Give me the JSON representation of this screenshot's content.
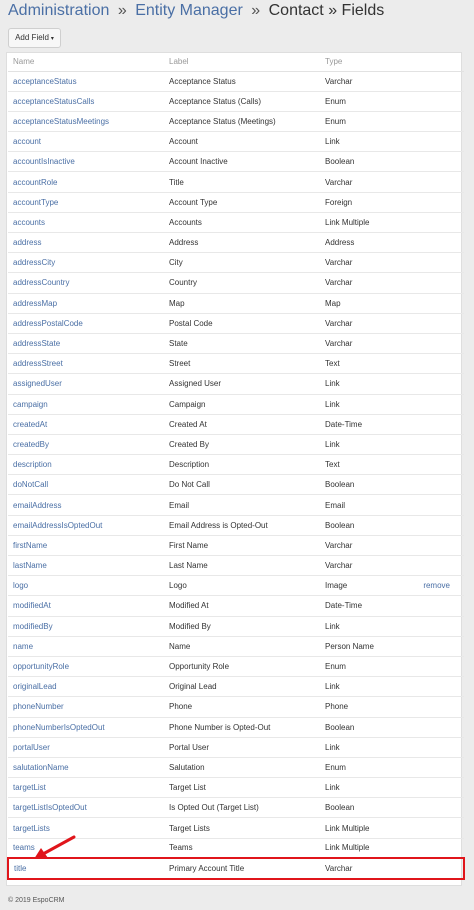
{
  "breadcrumb": {
    "administration": "Administration",
    "sep1": "»",
    "entity_manager": "Entity Manager",
    "sep2": "»",
    "current": "Contact » Fields"
  },
  "toolbar": {
    "add_field_label": "Add Field",
    "caret": "▾"
  },
  "table": {
    "headers": {
      "name": "Name",
      "label": "Label",
      "type": "Type"
    },
    "rows": [
      {
        "name": "acceptanceStatus",
        "label": "Acceptance Status",
        "type": "Varchar"
      },
      {
        "name": "acceptanceStatusCalls",
        "label": "Acceptance Status (Calls)",
        "type": "Enum"
      },
      {
        "name": "acceptanceStatusMeetings",
        "label": "Acceptance Status (Meetings)",
        "type": "Enum"
      },
      {
        "name": "account",
        "label": "Account",
        "type": "Link"
      },
      {
        "name": "accountIsInactive",
        "label": "Account Inactive",
        "type": "Boolean"
      },
      {
        "name": "accountRole",
        "label": "Title",
        "type": "Varchar"
      },
      {
        "name": "accountType",
        "label": "Account Type",
        "type": "Foreign"
      },
      {
        "name": "accounts",
        "label": "Accounts",
        "type": "Link Multiple"
      },
      {
        "name": "address",
        "label": "Address",
        "type": "Address"
      },
      {
        "name": "addressCity",
        "label": "City",
        "type": "Varchar"
      },
      {
        "name": "addressCountry",
        "label": "Country",
        "type": "Varchar"
      },
      {
        "name": "addressMap",
        "label": "Map",
        "type": "Map"
      },
      {
        "name": "addressPostalCode",
        "label": "Postal Code",
        "type": "Varchar"
      },
      {
        "name": "addressState",
        "label": "State",
        "type": "Varchar"
      },
      {
        "name": "addressStreet",
        "label": "Street",
        "type": "Text"
      },
      {
        "name": "assignedUser",
        "label": "Assigned User",
        "type": "Link"
      },
      {
        "name": "campaign",
        "label": "Campaign",
        "type": "Link"
      },
      {
        "name": "createdAt",
        "label": "Created At",
        "type": "Date-Time"
      },
      {
        "name": "createdBy",
        "label": "Created By",
        "type": "Link"
      },
      {
        "name": "description",
        "label": "Description",
        "type": "Text"
      },
      {
        "name": "doNotCall",
        "label": "Do Not Call",
        "type": "Boolean"
      },
      {
        "name": "emailAddress",
        "label": "Email",
        "type": "Email"
      },
      {
        "name": "emailAddressIsOptedOut",
        "label": "Email Address is Opted-Out",
        "type": "Boolean"
      },
      {
        "name": "firstName",
        "label": "First Name",
        "type": "Varchar"
      },
      {
        "name": "lastName",
        "label": "Last Name",
        "type": "Varchar"
      },
      {
        "name": "logo",
        "label": "Logo",
        "type": "Image",
        "action": "remove"
      },
      {
        "name": "modifiedAt",
        "label": "Modified At",
        "type": "Date-Time"
      },
      {
        "name": "modifiedBy",
        "label": "Modified By",
        "type": "Link"
      },
      {
        "name": "name",
        "label": "Name",
        "type": "Person Name"
      },
      {
        "name": "opportunityRole",
        "label": "Opportunity Role",
        "type": "Enum"
      },
      {
        "name": "originalLead",
        "label": "Original Lead",
        "type": "Link"
      },
      {
        "name": "phoneNumber",
        "label": "Phone",
        "type": "Phone"
      },
      {
        "name": "phoneNumberIsOptedOut",
        "label": "Phone Number is Opted-Out",
        "type": "Boolean"
      },
      {
        "name": "portalUser",
        "label": "Portal User",
        "type": "Link"
      },
      {
        "name": "salutationName",
        "label": "Salutation",
        "type": "Enum"
      },
      {
        "name": "targetList",
        "label": "Target List",
        "type": "Link"
      },
      {
        "name": "targetListIsOptedOut",
        "label": "Is Opted Out (Target List)",
        "type": "Boolean"
      },
      {
        "name": "targetLists",
        "label": "Target Lists",
        "type": "Link Multiple"
      },
      {
        "name": "teams",
        "label": "Teams",
        "type": "Link Multiple"
      },
      {
        "name": "title",
        "label": "Primary Account Title",
        "type": "Varchar",
        "highlighted": true
      }
    ]
  },
  "annotation": {
    "color": "#e0151b"
  },
  "footer": {
    "text": "© 2019 EspoCRM"
  }
}
